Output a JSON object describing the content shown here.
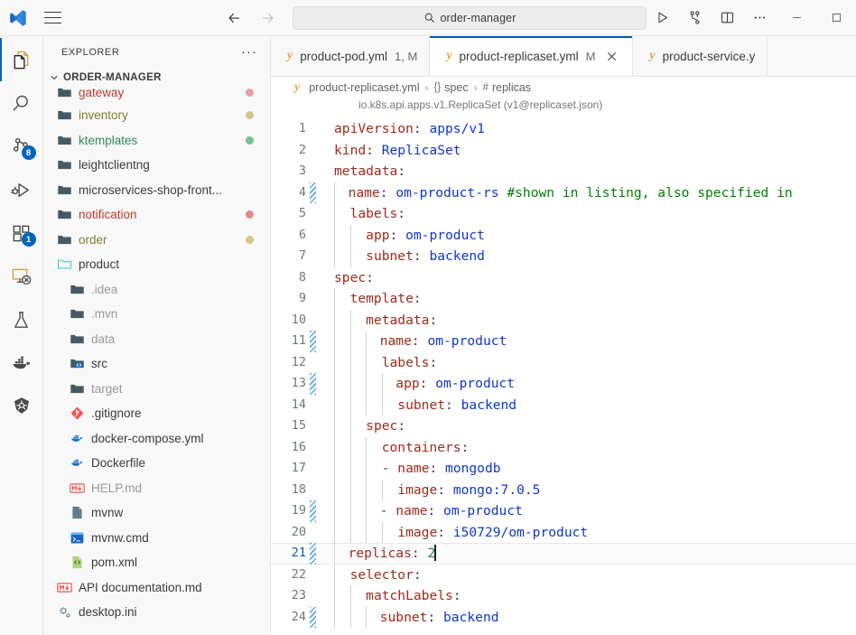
{
  "titlebar": {
    "logo_icon": "vscode-logo-icon",
    "menu_icon": "hamburger-menu-icon",
    "back_icon": "arrow-back-icon",
    "forward_icon": "arrow-forward-icon",
    "search": {
      "icon": "search-icon",
      "value": "order-manager",
      "placeholder": "Search"
    },
    "actions": [
      {
        "name": "run-code-button",
        "icon": "play-triangle-icon"
      },
      {
        "name": "source-control-graph-button",
        "icon": "git-branch-icon"
      },
      {
        "name": "toggle-panel-layout-button",
        "icon": "split-layout-icon"
      },
      {
        "name": "more-actions-button",
        "icon": "ellipsis-icon"
      }
    ],
    "window_controls": [
      {
        "name": "minimize-window-button",
        "icon": "minimize-icon"
      },
      {
        "name": "maximize-window-button",
        "icon": "maximize-icon"
      }
    ]
  },
  "activitybar": {
    "items": [
      {
        "name": "activity-explorer",
        "icon": "files-icon",
        "active": true,
        "badge": ""
      },
      {
        "name": "activity-search",
        "icon": "search-icon",
        "active": false,
        "badge": ""
      },
      {
        "name": "activity-source-control",
        "icon": "source-control-icon",
        "active": false,
        "badge": "8"
      },
      {
        "name": "activity-run-debug",
        "icon": "run-and-debug-icon",
        "active": false,
        "badge": ""
      },
      {
        "name": "activity-extensions",
        "icon": "extensions-icon",
        "active": false,
        "badge": "1"
      },
      {
        "name": "activity-remote-explorer",
        "icon": "remote-explorer-icon",
        "active": false,
        "badge": ""
      },
      {
        "name": "activity-testing",
        "icon": "beaker-flask-icon",
        "active": false,
        "badge": ""
      },
      {
        "name": "activity-docker",
        "icon": "docker-whale-icon",
        "active": false,
        "badge": ""
      },
      {
        "name": "activity-kubernetes",
        "icon": "kubernetes-helm-icon",
        "active": false,
        "badge": ""
      }
    ]
  },
  "sidebar": {
    "title": "EXPLORER",
    "more_icon": "ellipsis-icon",
    "chevron_icon": "chevron-down-icon",
    "root": "ORDER-MANAGER",
    "items": [
      {
        "label": "gateway",
        "icon": "folder-icon",
        "indent": 0,
        "color": "#c0392b",
        "dot": "#e8a0a0",
        "clipped": true
      },
      {
        "label": "inventory",
        "icon": "folder-icon",
        "indent": 0,
        "color": "#8a7a30",
        "dot": "#d4c68a"
      },
      {
        "label": "ktemplates",
        "icon": "folder-icon",
        "indent": 0,
        "color": "#2e8b57",
        "dot": "#73c48f"
      },
      {
        "label": "leightclientng",
        "icon": "folder-icon",
        "indent": 0,
        "color": "#3b3b3b",
        "dot": ""
      },
      {
        "label": "microservices-shop-front...",
        "icon": "folder-icon",
        "indent": 0,
        "color": "#3b3b3b",
        "dot": ""
      },
      {
        "label": "notification",
        "icon": "folder-icon",
        "indent": 0,
        "color": "#c0392b",
        "dot": "#e08a8a"
      },
      {
        "label": "order",
        "icon": "folder-icon",
        "indent": 0,
        "color": "#8a7a30",
        "dot": "#d4c68a"
      },
      {
        "label": "product",
        "icon": "folder-open-icon",
        "indent": 0,
        "color": "#3b3b3b",
        "dot": ""
      },
      {
        "label": ".idea",
        "icon": "folder-icon",
        "indent": 1,
        "color": "#9a9a9a",
        "dot": ""
      },
      {
        "label": ".mvn",
        "icon": "folder-icon",
        "indent": 1,
        "color": "#9a9a9a",
        "dot": ""
      },
      {
        "label": "data",
        "icon": "folder-icon",
        "indent": 1,
        "color": "#9a9a9a",
        "dot": ""
      },
      {
        "label": "src",
        "icon": "folder-src-icon",
        "indent": 1,
        "color": "#3b3b3b",
        "dot": ""
      },
      {
        "label": "target",
        "icon": "folder-icon",
        "indent": 1,
        "color": "#9a9a9a",
        "dot": ""
      },
      {
        "label": ".gitignore",
        "icon": "git-file-icon",
        "indent": 1,
        "color": "#3b3b3b",
        "dot": ""
      },
      {
        "label": "docker-compose.yml",
        "icon": "docker-whale-icon",
        "indent": 1,
        "color": "#3b3b3b",
        "dot": ""
      },
      {
        "label": "Dockerfile",
        "icon": "docker-whale-icon",
        "indent": 1,
        "color": "#3b3b3b",
        "dot": ""
      },
      {
        "label": "HELP.md",
        "icon": "markdown-icon",
        "indent": 1,
        "color": "#9a9a9a",
        "dot": ""
      },
      {
        "label": "mvnw",
        "icon": "generic-file-icon",
        "indent": 1,
        "color": "#3b3b3b",
        "dot": ""
      },
      {
        "label": "mvnw.cmd",
        "icon": "terminal-file-icon",
        "indent": 1,
        "color": "#3b3b3b",
        "dot": ""
      },
      {
        "label": "pom.xml",
        "icon": "xml-file-icon",
        "indent": 1,
        "color": "#3b3b3b",
        "dot": ""
      },
      {
        "label": "API documentation.md",
        "icon": "markdown-icon",
        "indent": 0,
        "color": "#3b3b3b",
        "dot": ""
      },
      {
        "label": "desktop.ini",
        "icon": "settings-file-icon",
        "indent": 0,
        "color": "#3b3b3b",
        "dot": ""
      }
    ]
  },
  "tabs": [
    {
      "name": "tab-product-pod",
      "icon": "yaml-icon",
      "label": "product-pod.yml",
      "status": "1, M",
      "active": false,
      "closable": false
    },
    {
      "name": "tab-product-replicaset",
      "icon": "yaml-icon",
      "label": "product-replicaset.yml",
      "status": "M",
      "active": true,
      "closable": true,
      "close_icon": "close-icon"
    },
    {
      "name": "tab-product-service",
      "icon": "yaml-icon",
      "label": "product-service.y",
      "status": "",
      "active": false,
      "closable": false
    }
  ],
  "breadcrumb": {
    "file_icon": "yaml-icon",
    "items": [
      {
        "label": "product-replicaset.yml",
        "symbol": ""
      },
      {
        "label": "spec",
        "symbol": "{}"
      },
      {
        "label": "replicas",
        "symbol": "#"
      }
    ],
    "separator": "›"
  },
  "schema_hint": "io.k8s.api.apps.v1.ReplicaSet (v1@replicaset.json)",
  "editor": {
    "cursor_line": 21,
    "lines": [
      {
        "n": 1,
        "modified": false,
        "indent_guides": 0,
        "tokens": [
          {
            "t": "key",
            "v": "apiVersion"
          },
          {
            "t": "punct",
            "v": ": "
          },
          {
            "t": "val",
            "v": "apps/v1"
          }
        ]
      },
      {
        "n": 2,
        "modified": false,
        "indent_guides": 0,
        "tokens": [
          {
            "t": "key",
            "v": "kind"
          },
          {
            "t": "punct",
            "v": ": "
          },
          {
            "t": "val",
            "v": "ReplicaSet"
          }
        ]
      },
      {
        "n": 3,
        "modified": false,
        "indent_guides": 0,
        "tokens": [
          {
            "t": "key",
            "v": "metadata"
          },
          {
            "t": "punct",
            "v": ":"
          }
        ]
      },
      {
        "n": 4,
        "modified": true,
        "indent_guides": 1,
        "tokens": [
          {
            "t": "punct",
            "v": "  "
          },
          {
            "t": "key",
            "v": "name"
          },
          {
            "t": "punct",
            "v": ": "
          },
          {
            "t": "val",
            "v": "om-product-rs"
          },
          {
            "t": "punct",
            "v": " "
          },
          {
            "t": "com",
            "v": "#shown in listing, also specified in"
          }
        ]
      },
      {
        "n": 5,
        "modified": false,
        "indent_guides": 1,
        "tokens": [
          {
            "t": "punct",
            "v": "  "
          },
          {
            "t": "key",
            "v": "labels"
          },
          {
            "t": "punct",
            "v": ":"
          }
        ]
      },
      {
        "n": 6,
        "modified": false,
        "indent_guides": 2,
        "tokens": [
          {
            "t": "punct",
            "v": "    "
          },
          {
            "t": "key",
            "v": "app"
          },
          {
            "t": "punct",
            "v": ": "
          },
          {
            "t": "val",
            "v": "om-product"
          }
        ]
      },
      {
        "n": 7,
        "modified": false,
        "indent_guides": 2,
        "tokens": [
          {
            "t": "punct",
            "v": "    "
          },
          {
            "t": "key",
            "v": "subnet"
          },
          {
            "t": "punct",
            "v": ": "
          },
          {
            "t": "val",
            "v": "backend"
          }
        ]
      },
      {
        "n": 8,
        "modified": false,
        "indent_guides": 0,
        "tokens": [
          {
            "t": "key",
            "v": "spec"
          },
          {
            "t": "punct",
            "v": ":"
          }
        ]
      },
      {
        "n": 9,
        "modified": false,
        "indent_guides": 1,
        "tokens": [
          {
            "t": "punct",
            "v": "  "
          },
          {
            "t": "key",
            "v": "template"
          },
          {
            "t": "punct",
            "v": ":"
          }
        ]
      },
      {
        "n": 10,
        "modified": false,
        "indent_guides": 2,
        "tokens": [
          {
            "t": "punct",
            "v": "    "
          },
          {
            "t": "key",
            "v": "metadata"
          },
          {
            "t": "punct",
            "v": ":"
          }
        ]
      },
      {
        "n": 11,
        "modified": true,
        "indent_guides": 3,
        "tokens": [
          {
            "t": "punct",
            "v": "      "
          },
          {
            "t": "key",
            "v": "name"
          },
          {
            "t": "punct",
            "v": ": "
          },
          {
            "t": "val",
            "v": "om-product"
          }
        ]
      },
      {
        "n": 12,
        "modified": false,
        "indent_guides": 3,
        "tokens": [
          {
            "t": "punct",
            "v": "      "
          },
          {
            "t": "key",
            "v": "labels"
          },
          {
            "t": "punct",
            "v": ":"
          }
        ]
      },
      {
        "n": 13,
        "modified": true,
        "indent_guides": 4,
        "tokens": [
          {
            "t": "punct",
            "v": "        "
          },
          {
            "t": "key",
            "v": "app"
          },
          {
            "t": "punct",
            "v": ": "
          },
          {
            "t": "val",
            "v": "om-product"
          }
        ]
      },
      {
        "n": 14,
        "modified": false,
        "indent_guides": 4,
        "tokens": [
          {
            "t": "punct",
            "v": "        "
          },
          {
            "t": "key",
            "v": "subnet"
          },
          {
            "t": "punct",
            "v": ": "
          },
          {
            "t": "val",
            "v": "backend"
          }
        ]
      },
      {
        "n": 15,
        "modified": false,
        "indent_guides": 2,
        "tokens": [
          {
            "t": "punct",
            "v": "    "
          },
          {
            "t": "key",
            "v": "spec"
          },
          {
            "t": "punct",
            "v": ":"
          }
        ]
      },
      {
        "n": 16,
        "modified": false,
        "indent_guides": 3,
        "tokens": [
          {
            "t": "punct",
            "v": "      "
          },
          {
            "t": "key",
            "v": "containers"
          },
          {
            "t": "punct",
            "v": ":"
          }
        ]
      },
      {
        "n": 17,
        "modified": false,
        "indent_guides": 3,
        "tokens": [
          {
            "t": "punct",
            "v": "      "
          },
          {
            "t": "dash",
            "v": "- "
          },
          {
            "t": "key",
            "v": "name"
          },
          {
            "t": "punct",
            "v": ": "
          },
          {
            "t": "val",
            "v": "mongodb"
          }
        ]
      },
      {
        "n": 18,
        "modified": false,
        "indent_guides": 4,
        "tokens": [
          {
            "t": "punct",
            "v": "        "
          },
          {
            "t": "key",
            "v": "image"
          },
          {
            "t": "punct",
            "v": ": "
          },
          {
            "t": "val",
            "v": "mongo:7.0.5"
          }
        ]
      },
      {
        "n": 19,
        "modified": true,
        "indent_guides": 3,
        "tokens": [
          {
            "t": "punct",
            "v": "      "
          },
          {
            "t": "dash",
            "v": "- "
          },
          {
            "t": "key",
            "v": "name"
          },
          {
            "t": "punct",
            "v": ": "
          },
          {
            "t": "val",
            "v": "om-product"
          }
        ]
      },
      {
        "n": 20,
        "modified": false,
        "indent_guides": 4,
        "tokens": [
          {
            "t": "punct",
            "v": "        "
          },
          {
            "t": "key",
            "v": "image"
          },
          {
            "t": "punct",
            "v": ": "
          },
          {
            "t": "val",
            "v": "i50729/om-product"
          }
        ]
      },
      {
        "n": 21,
        "modified": true,
        "indent_guides": 1,
        "tokens": [
          {
            "t": "punct",
            "v": "  "
          },
          {
            "t": "key",
            "v": "replicas"
          },
          {
            "t": "punct",
            "v": ": "
          },
          {
            "t": "num",
            "v": "2"
          }
        ],
        "cursor": true
      },
      {
        "n": 22,
        "modified": false,
        "indent_guides": 1,
        "tokens": [
          {
            "t": "punct",
            "v": "  "
          },
          {
            "t": "key",
            "v": "selector"
          },
          {
            "t": "punct",
            "v": ":"
          }
        ]
      },
      {
        "n": 23,
        "modified": false,
        "indent_guides": 2,
        "tokens": [
          {
            "t": "punct",
            "v": "    "
          },
          {
            "t": "key",
            "v": "matchLabels"
          },
          {
            "t": "punct",
            "v": ":"
          }
        ]
      },
      {
        "n": 24,
        "modified": true,
        "indent_guides": 3,
        "tokens": [
          {
            "t": "punct",
            "v": "      "
          },
          {
            "t": "key",
            "v": "subnet"
          },
          {
            "t": "punct",
            "v": ": "
          },
          {
            "t": "val",
            "v": "backend"
          }
        ]
      }
    ]
  }
}
